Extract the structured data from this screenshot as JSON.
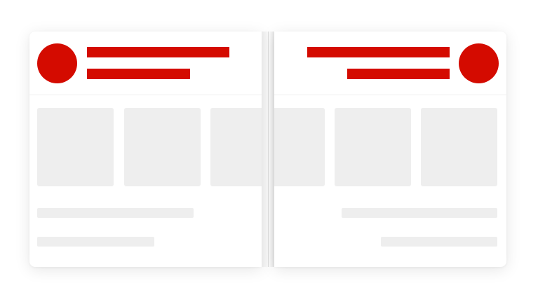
{
  "colors": {
    "accent": "#d40b00",
    "placeholder": "#eeeeee",
    "background": "#ffffff",
    "fold": "#e6e6e6"
  },
  "left_panel": {
    "avatar_icon": "avatar-placeholder",
    "title_placeholder": "",
    "subtitle_placeholder": "",
    "tiles": [
      "",
      "",
      ""
    ],
    "lines": [
      "",
      ""
    ]
  },
  "right_panel": {
    "avatar_icon": "avatar-placeholder",
    "title_placeholder": "",
    "subtitle_placeholder": "",
    "tiles": [
      "",
      "",
      ""
    ],
    "lines": [
      "",
      ""
    ]
  }
}
